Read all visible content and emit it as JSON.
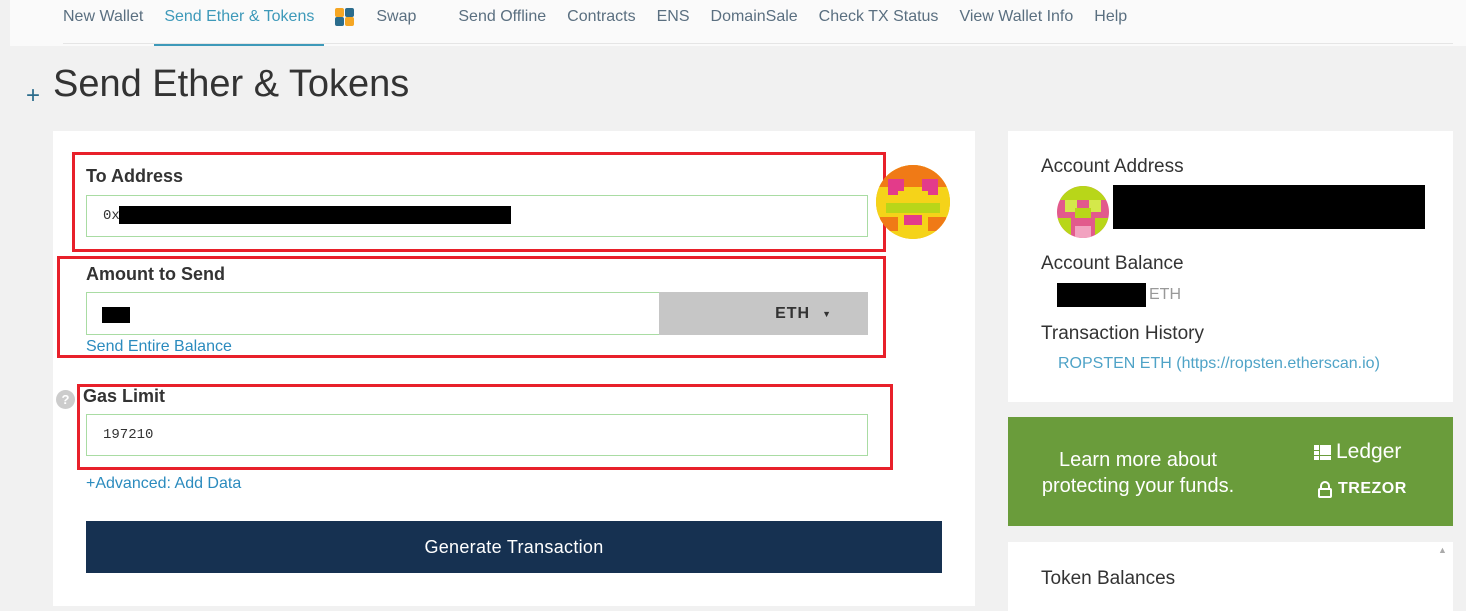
{
  "nav": {
    "items": [
      "New Wallet",
      "Send Ether & Tokens",
      "Swap",
      "Send Offline",
      "Contracts",
      "ENS",
      "DomainSale",
      "Check TX Status",
      "View Wallet Info",
      "Help"
    ],
    "active_index": 1
  },
  "page": {
    "plus": "+",
    "title": "Send Ether & Tokens"
  },
  "form": {
    "to_address_label": "To Address",
    "to_address_value": "0x",
    "amount_label": "Amount to Send",
    "currency": "ETH",
    "send_entire_balance": "Send Entire Balance",
    "gas_limit_label": "Gas Limit",
    "gas_limit_value": "197210",
    "advanced_link": "+Advanced: Add Data",
    "generate_button": "Generate Transaction",
    "help_icon": "?"
  },
  "sidebar": {
    "account_address_label": "Account Address",
    "account_balance_label": "Account Balance",
    "balance_unit": "ETH",
    "tx_history_label": "Transaction History",
    "tx_history_link": "ROPSTEN ETH (https://ropsten.etherscan.io)"
  },
  "promo": {
    "text": "Learn more about protecting your funds.",
    "ledger": "Ledger",
    "trezor": "TREZOR",
    "background": "#6a9c3b"
  },
  "tokens": {
    "heading": "Token Balances"
  },
  "colors": {
    "accent": "#3d99b9",
    "link": "#2b8bbe",
    "button": "#163151",
    "highlight_box": "#e8202a",
    "field_border": "#a9dca3"
  }
}
